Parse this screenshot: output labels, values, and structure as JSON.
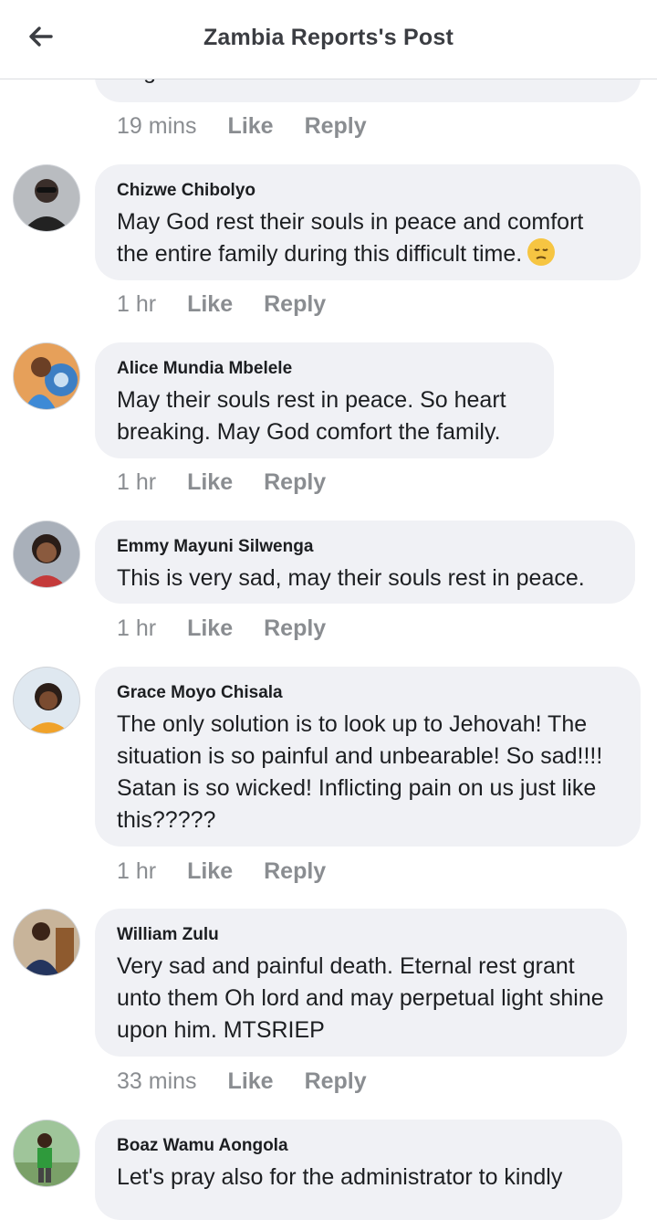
{
  "header": {
    "title": "Zambia Reports's Post"
  },
  "prev": {
    "text": "forgive us and heal our land.",
    "time": "19 mins",
    "like": "Like",
    "reply": "Reply"
  },
  "comments": [
    {
      "author": "Chizwe Chibolyo",
      "text": "May God rest their souls in peace and comfort the entire family during this difficult time.",
      "emoji": "pensive-face",
      "time": "1 hr",
      "like": "Like",
      "reply": "Reply"
    },
    {
      "author": "Alice Mundia Mbelele",
      "text": "May their souls rest in peace. So heart breaking. May God comfort the family.",
      "time": "1 hr",
      "like": "Like",
      "reply": "Reply"
    },
    {
      "author": "Emmy Mayuni Silwenga",
      "text": "This is very sad, may their souls rest in peace.",
      "time": "1 hr",
      "like": "Like",
      "reply": "Reply"
    },
    {
      "author": "Grace Moyo Chisala",
      "text": "The only solution is to look up to Jehovah! The situation is so painful and unbearable! So sad!!!! Satan is so wicked! Inflicting pain on us just like this?????",
      "time": "1 hr",
      "like": "Like",
      "reply": "Reply"
    },
    {
      "author": "William Zulu",
      "text": "Very sad and painful death. Eternal rest grant unto them Oh lord and may perpetual light shine upon him. MTSRIEP",
      "time": "33 mins",
      "like": "Like",
      "reply": "Reply"
    },
    {
      "author": "Boaz Wamu Aongola",
      "text": "Let's pray also for the administrator to kindly"
    }
  ],
  "colors": {
    "bubble": "#f0f1f5",
    "meta": "#8a8d91",
    "title": "#3b3d42"
  }
}
